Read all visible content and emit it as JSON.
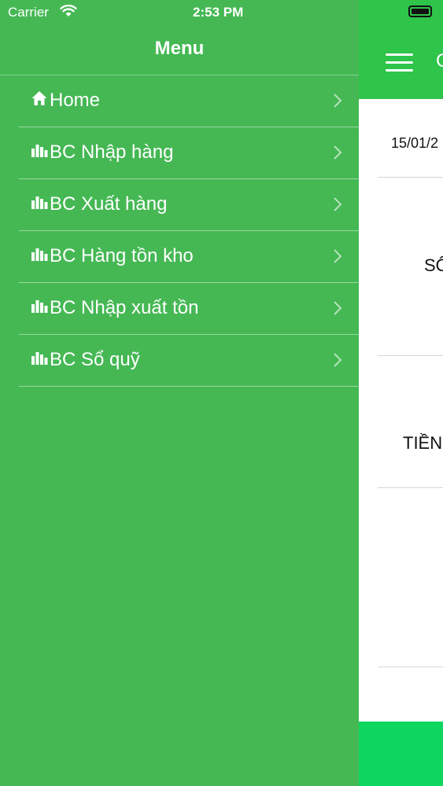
{
  "status_bar": {
    "carrier": "Carrier",
    "time": "2:53 PM"
  },
  "drawer": {
    "title": "Menu",
    "items": [
      {
        "label": "Home",
        "icon": "home-icon"
      },
      {
        "label": "BC Nhập hàng",
        "icon": "bar-chart-icon"
      },
      {
        "label": "BC Xuất hàng",
        "icon": "bar-chart-icon"
      },
      {
        "label": "BC Hàng tồn kho",
        "icon": "bar-chart-icon"
      },
      {
        "label": "BC Nhập xuất tồn",
        "icon": "bar-chart-icon"
      },
      {
        "label": "BC Sổ quỹ",
        "icon": "bar-chart-icon"
      }
    ]
  },
  "background_screen": {
    "title_fragment": "C",
    "date_fragment": "15/01/2",
    "label_1_fragment": "SỐ",
    "label_2_fragment": "TIỀN"
  },
  "colors": {
    "drawer_bg": "#45b854",
    "header_bg": "#2fc44a",
    "footer_bg": "#0fd65e"
  }
}
